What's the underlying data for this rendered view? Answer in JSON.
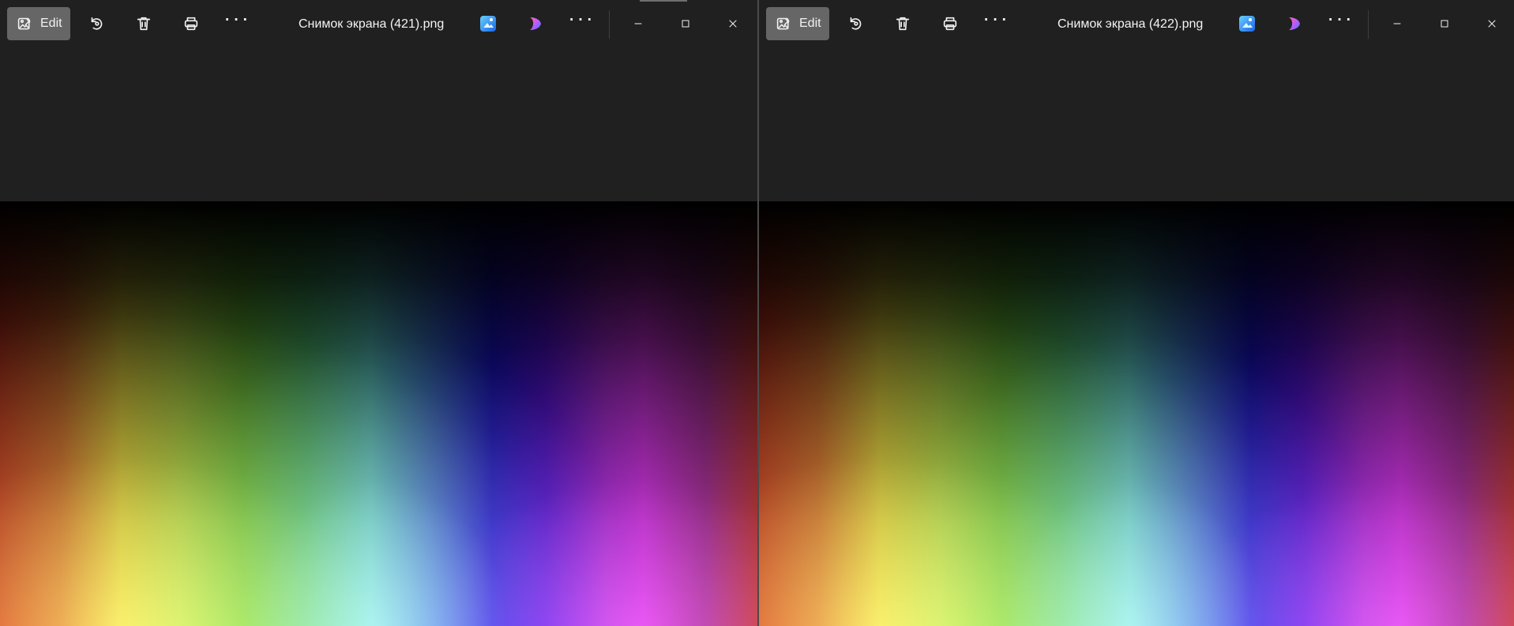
{
  "windows": [
    {
      "filename": "Снимок экрана (421).png",
      "toolbar": {
        "edit_label": "Edit",
        "icons": {
          "edit": "edit-image-icon",
          "rotate": "rotate-icon",
          "delete": "trash-icon",
          "print": "printer-icon",
          "more": "more-horizontal-icon",
          "photos": "photos-app-icon",
          "designer": "designer-app-icon",
          "minimize": "minimize-icon",
          "maximize": "maximize-icon",
          "close": "close-icon"
        }
      }
    },
    {
      "filename": "Снимок экрана (422).png",
      "toolbar": {
        "edit_label": "Edit",
        "icons": {
          "edit": "edit-image-icon",
          "rotate": "rotate-icon",
          "delete": "trash-icon",
          "print": "printer-icon",
          "more": "more-horizontal-icon",
          "photos": "photos-app-icon",
          "designer": "designer-app-icon",
          "minimize": "minimize-icon",
          "maximize": "maximize-icon",
          "close": "close-icon"
        }
      }
    }
  ],
  "colors": {
    "chrome_background": "#202020",
    "edit_button_background": "#666666",
    "text": "#f4f4f4"
  },
  "symbols": {
    "more": "···"
  }
}
